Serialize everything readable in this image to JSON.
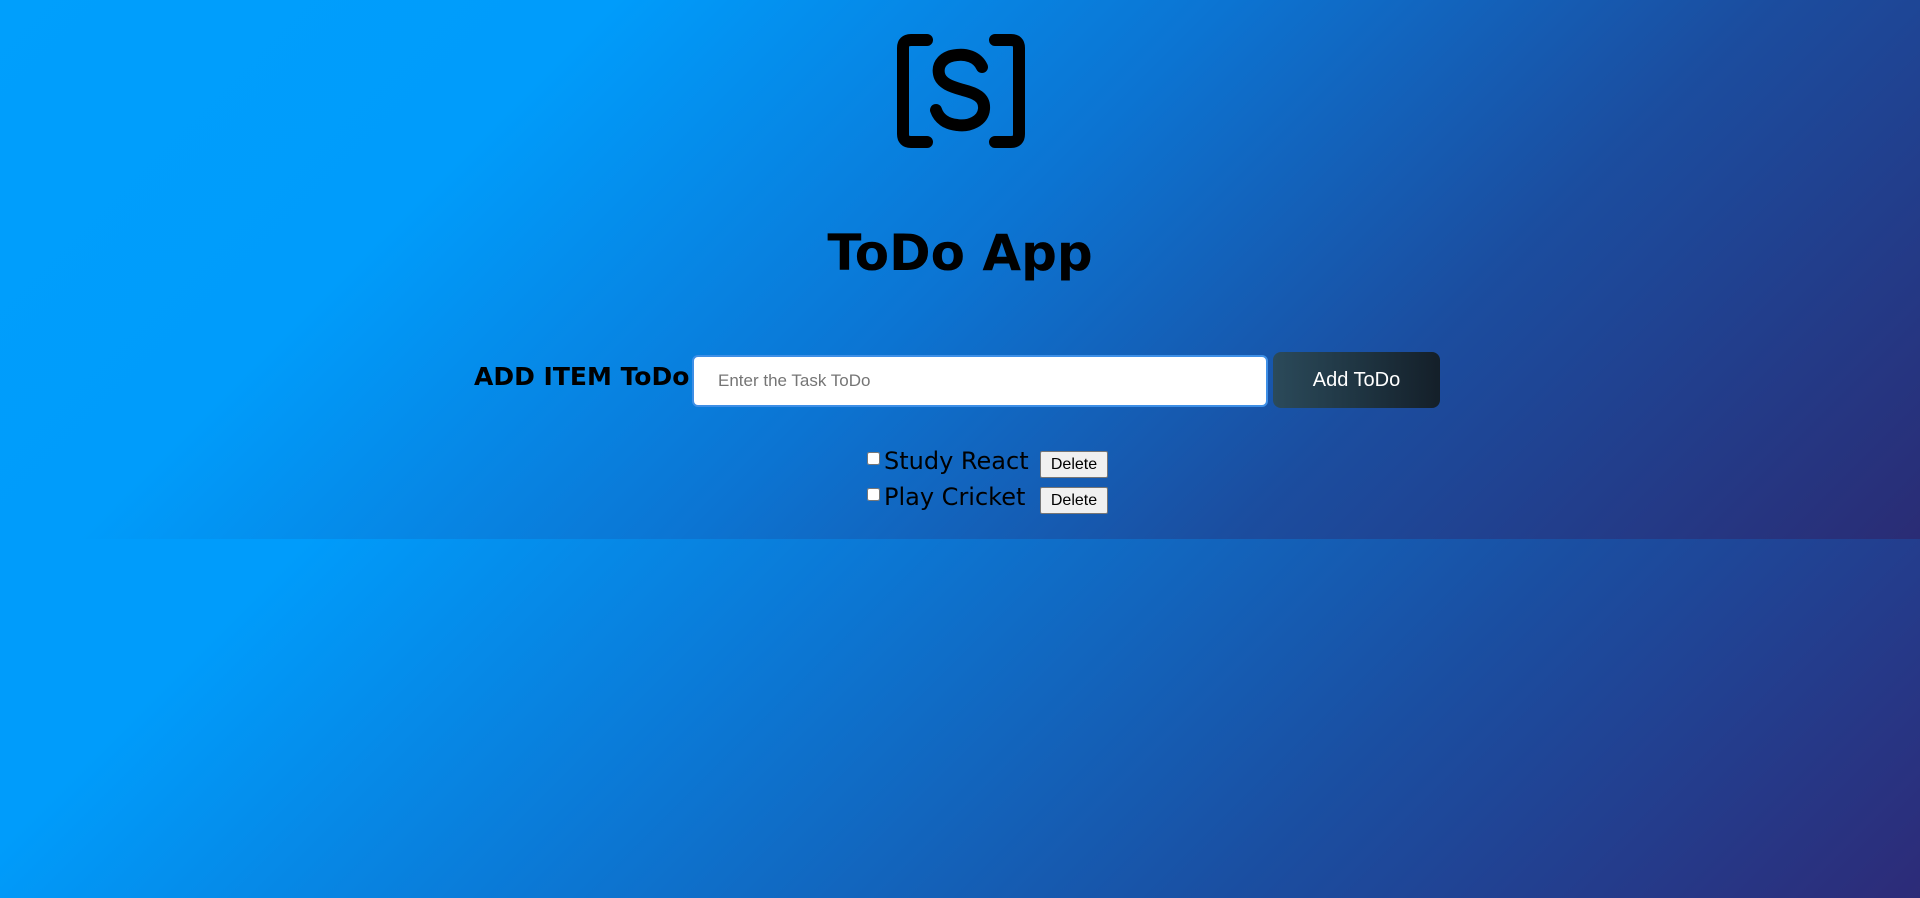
{
  "app": {
    "logo_icon": "bracket-s-logo-icon",
    "title": "ToDo App"
  },
  "add_form": {
    "label": "ADD ITEM ToDo :",
    "input_value": "",
    "input_placeholder": "Enter the Task ToDo",
    "button_label": "Add ToDo"
  },
  "todos": [
    {
      "text": "Study React",
      "checked": false,
      "delete_label": "Delete"
    },
    {
      "text": "Play Cricket",
      "checked": false,
      "delete_label": "Delete"
    }
  ],
  "colors": {
    "background_start": "#009cfb",
    "background_end": "#2d2b78",
    "button_bg": "#1e3340",
    "input_border": "#3e8fe6"
  }
}
